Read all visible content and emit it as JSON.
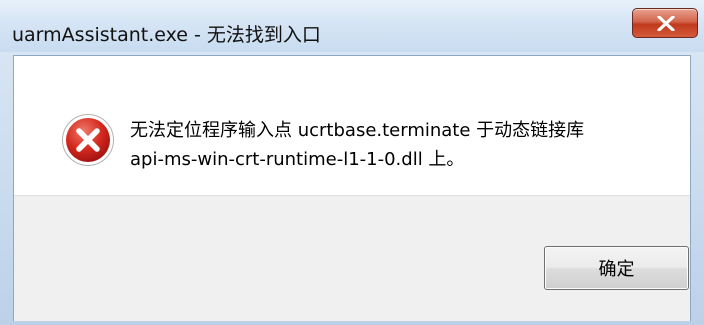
{
  "window": {
    "title": "uarmAssistant.exe - 无法找到入口",
    "close_icon": "close-icon"
  },
  "message": {
    "icon": "error-icon",
    "line1": "无法定位程序输入点 ucrtbase.terminate 于动态链接库",
    "line2": "api-ms-win-crt-runtime-l1-1-0.dll 上。"
  },
  "buttons": {
    "ok_label": "确定"
  },
  "colors": {
    "close_button": "#c7432a",
    "error_icon": "#c81f1f",
    "titlebar": "#d6e5f5"
  }
}
